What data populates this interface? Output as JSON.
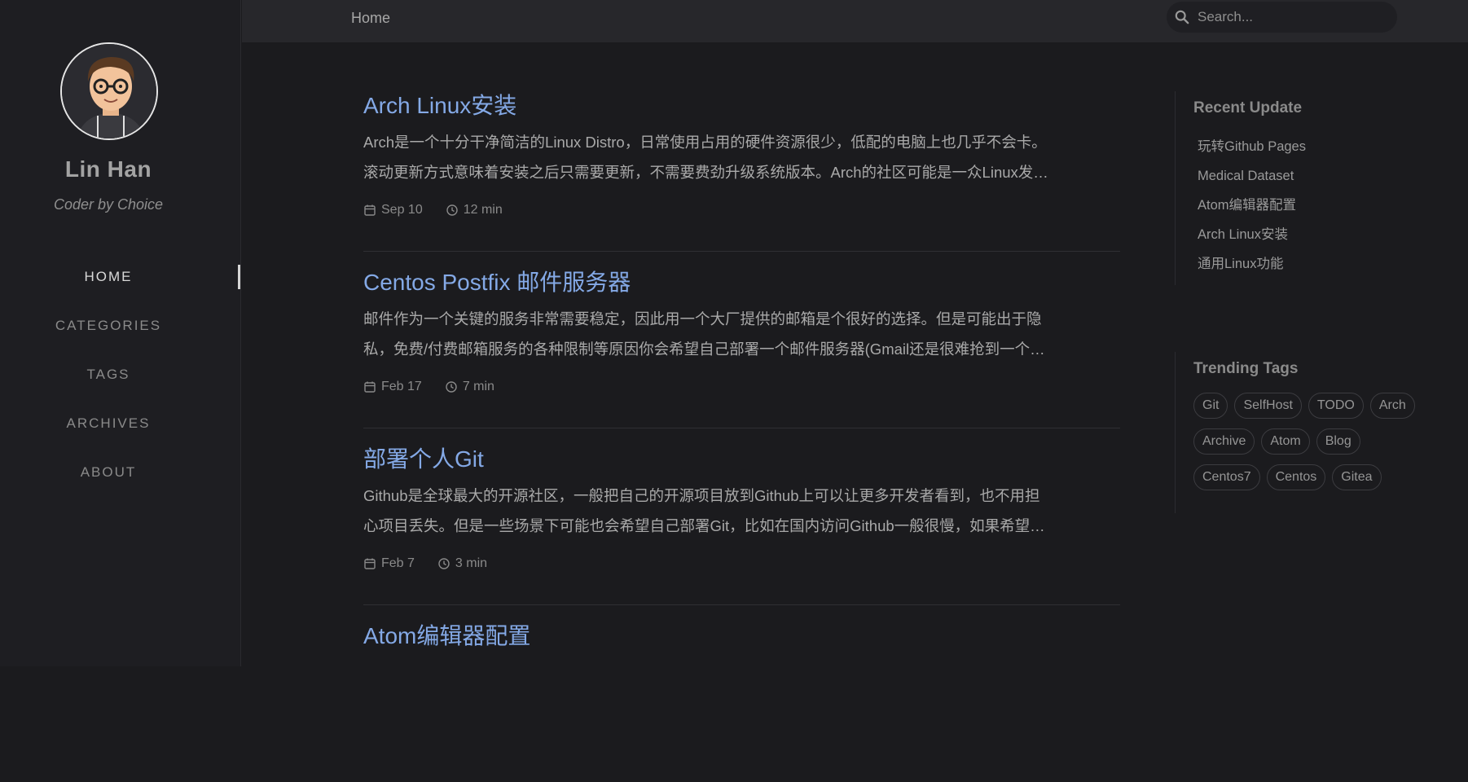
{
  "sidebar": {
    "title": "Lin Han",
    "subtitle": "Coder by Choice",
    "nav": [
      "HOME",
      "CATEGORIES",
      "TAGS",
      "ARCHIVES",
      "ABOUT"
    ],
    "active": "HOME"
  },
  "topbar": {
    "breadcrumb": "Home",
    "search_placeholder": "Search..."
  },
  "posts": [
    {
      "title": "Arch Linux安装",
      "excerpt_line1": "Arch是一个十分干净简洁的Linux Distro，日常使用占用的硬件资源很少，低配的电脑上也几乎不会卡。",
      "excerpt_line2": "滚动更新方式意味着安装之后只需要更新，不需要费劲升级系统版本。Arch的社区可能是一众Linux发…",
      "date": "Sep 10",
      "read_time": "12 min"
    },
    {
      "title": "Centos Postfix 邮件服务器",
      "excerpt_line1": "邮件作为一个关键的服务非常需要稳定，因此用一个大厂提供的邮箱是个很好的选择。但是可能出于隐",
      "excerpt_line2": "私，免费/付费邮箱服务的各种限制等原因你会希望自己部署一个邮件服务器(Gmail还是很难抢到一个…",
      "date": "Feb 17",
      "read_time": "7 min"
    },
    {
      "title": "部署个人Git",
      "excerpt_line1": "Github是全球最大的开源社区，一般把自己的开源项目放到Github上可以让更多开发者看到，也不用担",
      "excerpt_line2": "心项目丢失。但是一些场景下可能也会希望自己部署Git，比如在国内访问Github一般很慢，如果希望…",
      "date": "Feb 7",
      "read_time": "3 min"
    },
    {
      "title": "Atom编辑器配置",
      "excerpt_line1": "",
      "excerpt_line2": "",
      "date": "",
      "read_time": ""
    }
  ],
  "recent_update": {
    "heading": "Recent Update",
    "items": [
      "玩转Github Pages",
      "Medical Dataset",
      "Atom编辑器配置",
      "Arch Linux安装",
      "通用Linux功能"
    ]
  },
  "trending_tags": {
    "heading": "Trending Tags",
    "tags": [
      "Git",
      "SelfHost",
      "TODO",
      "Arch",
      "Archive",
      "Atom",
      "Blog",
      "Centos7",
      "Centos",
      "Gitea"
    ]
  },
  "colors": {
    "accent": "#84a9e6",
    "background": "#1b1b1e",
    "sidebar": "#1e1e22",
    "topbar": "#27272b"
  }
}
